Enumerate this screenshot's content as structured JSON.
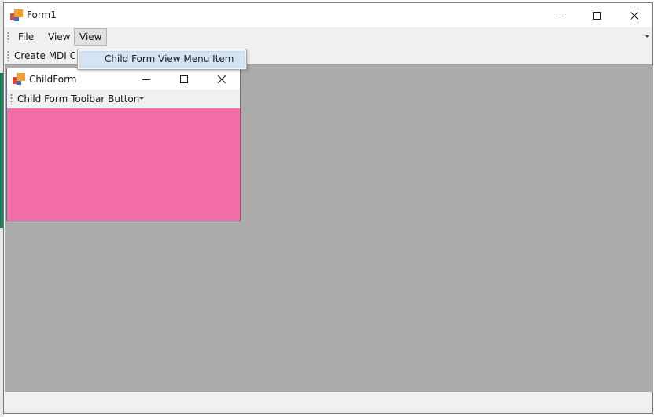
{
  "window": {
    "title": "Form1",
    "caption_buttons": [
      "minimize",
      "maximize",
      "close"
    ]
  },
  "menubar": {
    "items": [
      {
        "label": "File"
      },
      {
        "label": "View"
      },
      {
        "label": "View"
      }
    ]
  },
  "toolbar": {
    "create_button_label": "Create MDI Child"
  },
  "view_menu": {
    "items": [
      {
        "label": "Child Form View Menu Item"
      }
    ]
  },
  "child_form": {
    "title": "ChildForm",
    "toolbar_button_label": "Child Form Toolbar Button",
    "body_color": "#f36ea8"
  },
  "colors": {
    "mdi_background": "#ababab",
    "menu_highlight": "#d5e4f5",
    "chrome": "#f0f0f0"
  },
  "icons": {
    "app": "app-icon",
    "minimize": "minimize-icon",
    "maximize": "maximize-icon",
    "close": "close-icon",
    "grip": "grip-icon",
    "dropdown": "chevron-down-icon"
  }
}
